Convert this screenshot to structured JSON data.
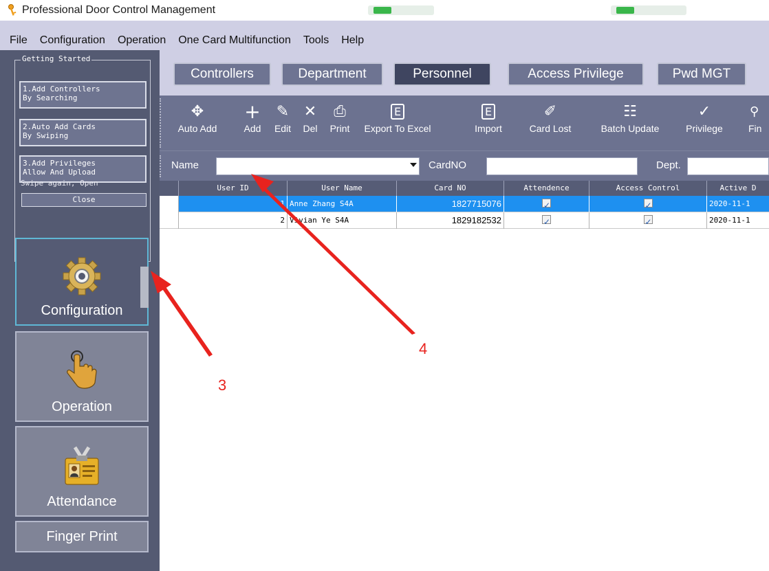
{
  "window": {
    "title": "Professional Door Control Management"
  },
  "menu": [
    "File",
    "Configuration",
    "Operation",
    "One Card Multifunction",
    "Tools",
    "Help"
  ],
  "getting_started": {
    "title": "Getting Started",
    "steps": [
      "1.Add Controllers\nBy Searching",
      "2.Auto Add Cards\nBy Swiping",
      "3.Add Privileges\nAllow And Upload"
    ],
    "swipe_text": "Swipe again, Open",
    "close_label": "Close"
  },
  "nav": {
    "configuration": "Configuration",
    "operation": "Operation",
    "attendance": "Attendance",
    "finger_print": "Finger Print"
  },
  "tabs": [
    "Controllers",
    "Department",
    "Personnel",
    "Access Privilege",
    "Pwd MGT"
  ],
  "toolbar": [
    "Auto Add",
    "Add",
    "Edit",
    "Del",
    "Print",
    "Export To Excel",
    "Import",
    "Card Lost",
    "Batch Update",
    "Privilege",
    "Fin"
  ],
  "filters": {
    "name_label": "Name",
    "cardno_label": "CardNO",
    "dept_label": "Dept."
  },
  "table": {
    "columns": [
      "User ID",
      "User Name",
      "Card NO",
      "Attendence",
      "Access Control",
      "Active D"
    ],
    "rows": [
      {
        "id": "1",
        "name": "Anne Zhang S4A",
        "card": "1827715076",
        "attendance": true,
        "access": true,
        "active": "2020-11-1",
        "selected": true
      },
      {
        "id": "2",
        "name": "Vivian Ye S4A",
        "card": "1829182532",
        "attendance": true,
        "access": true,
        "active": "2020-11-1",
        "selected": false
      }
    ]
  },
  "annotations": {
    "arrow3": "3",
    "arrow4": "4"
  }
}
